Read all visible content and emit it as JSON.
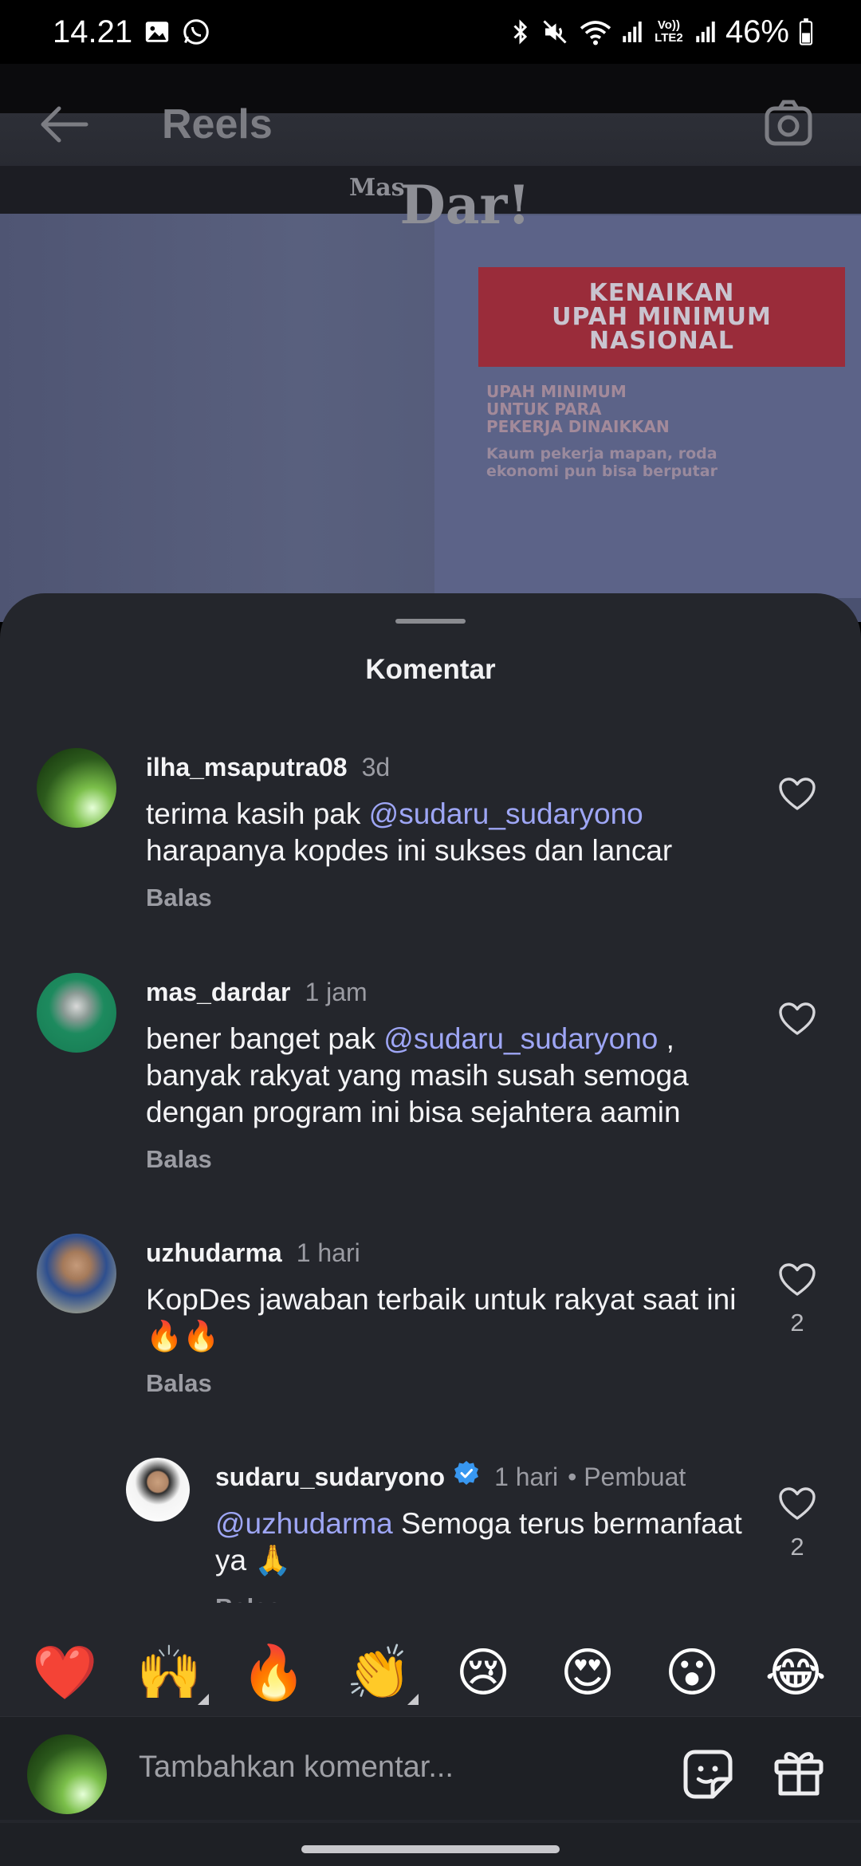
{
  "status_bar": {
    "time": "14.21",
    "battery": "46%",
    "volte": "Vo)) LTE2"
  },
  "header": {
    "title": "Reels"
  },
  "video": {
    "logo_small": "Mas",
    "logo_big": "Dar!",
    "headline_lines": [
      "KENAIKAN",
      "UPAH MINIMUM",
      "NASIONAL"
    ],
    "sub_lines": [
      "UPAH MINIMUM",
      "UNTUK PARA",
      "PEKERJA DINAIKKAN"
    ],
    "caption_lines": [
      "Kaum pekerja mapan, roda",
      "ekonomi pun bisa berputar"
    ]
  },
  "sheet": {
    "title": "Komentar",
    "reply_label": "Balas"
  },
  "comments": [
    {
      "user": "ilha_msaputra08",
      "time": "3d",
      "text_before": "terima kasih pak ",
      "mention": "@sudaru_sudaryono",
      "text_after": "harapanya kopdes ini sukses dan lancar",
      "likes": ""
    },
    {
      "user": "mas_dardar",
      "time": "1 jam",
      "text_before": "bener banget pak ",
      "mention": "@sudaru_sudaryono",
      "text_after": " , banyak rakyat yang masih susah semoga dengan program ini bisa sejahtera aamin",
      "likes": ""
    },
    {
      "user": "uzhudarma",
      "time": "1 hari",
      "text": "KopDes jawaban terbaik untuk rakyat saat ini 🔥🔥",
      "likes": "2"
    },
    {
      "user": "sudaru_sudaryono",
      "time": "1 hari",
      "creator_label": "• Pembuat",
      "mention": "@uzhudarma",
      "text_after": " Semoga terus bermanfaat ya 🙏",
      "likes": "2",
      "verified": true
    }
  ],
  "emoji_bar": [
    "❤️",
    "🙌",
    "🔥",
    "👏",
    "😢",
    "😍",
    "😮",
    "😂"
  ],
  "composer": {
    "placeholder": "Tambahkan komentar..."
  },
  "colors": {
    "sheet_bg": "#24262c",
    "mention": "#9ea6f5",
    "muted": "#9b9ca3",
    "verified": "#3897f0"
  }
}
